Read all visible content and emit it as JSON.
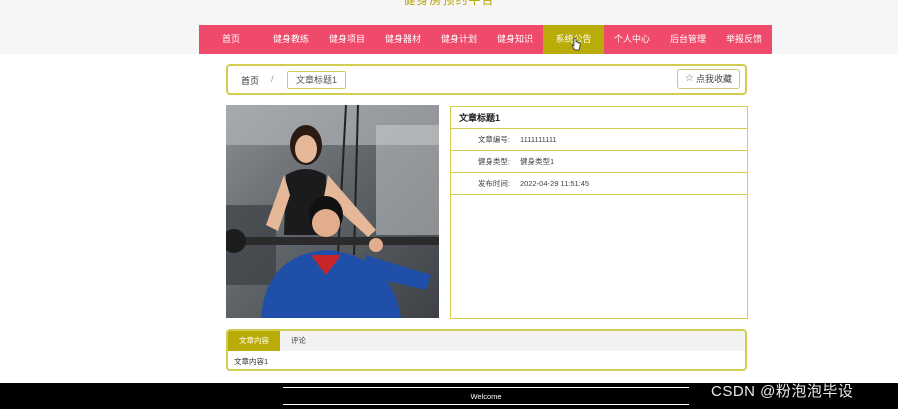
{
  "site": {
    "title": "健身房预约平台"
  },
  "nav": {
    "items": [
      {
        "label": "首页"
      },
      {
        "label": "健身教练"
      },
      {
        "label": "健身项目"
      },
      {
        "label": "健身器材"
      },
      {
        "label": "健身计划"
      },
      {
        "label": "健身知识"
      },
      {
        "label": "系统公告"
      },
      {
        "label": "个人中心"
      },
      {
        "label": "后台管理"
      },
      {
        "label": "举报反馈"
      }
    ],
    "active_index": 6,
    "active_color": "#b9ac08",
    "bar_color": "#ef4a6b"
  },
  "breadcrumb": {
    "home": "首页",
    "separator": "/",
    "current": "文章标题1"
  },
  "favorite_button": {
    "label": "点我收藏",
    "icon": "star-outline-icon"
  },
  "article": {
    "title": "文章标题1",
    "fields": [
      {
        "label": "文章编号:",
        "value": "1111111111"
      },
      {
        "label": "健身类型:",
        "value": "健身类型1"
      },
      {
        "label": "发布时间:",
        "value": "2022-04-29 11:51:45"
      }
    ]
  },
  "tabs": [
    {
      "label": "文章内容"
    },
    {
      "label": "评论"
    }
  ],
  "content": {
    "text": "文章内容1"
  },
  "footer": {
    "text": "Welcome"
  },
  "watermark": {
    "text": "CSDN @粉泡泡毕设"
  },
  "colors": {
    "accent_border": "#d3cc52"
  }
}
